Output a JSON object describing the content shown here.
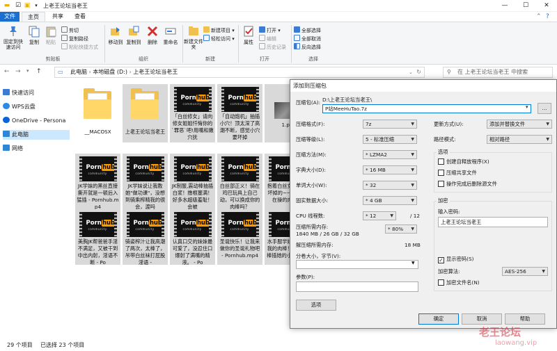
{
  "window": {
    "title": "上老王论坛当老王",
    "controls": [
      "—",
      "☐",
      "✕"
    ]
  },
  "ribbon": {
    "tabs": [
      "文件",
      "主页",
      "共享",
      "查看"
    ],
    "clipboard": {
      "pin": "固定到快速访问",
      "copy": "复制",
      "paste": "粘贴",
      "cut": "剪切",
      "copy_path": "复制路径",
      "paste_shortcut": "粘贴快捷方式",
      "group": "剪贴板"
    },
    "organize": {
      "move_to": "移动到",
      "copy_to": "复制到",
      "delete": "删除",
      "rename": "重命名",
      "group": "组织"
    },
    "new": {
      "new_folder": "新建文件夹",
      "new_item": "新建项目 ▾",
      "easy_access": "轻松访问 ▾",
      "group": "新建"
    },
    "open": {
      "properties": "属性",
      "open": "打开 ▾",
      "edit": "编辑",
      "history": "历史记录",
      "group": "打开"
    },
    "select": {
      "select_all": "全部选择",
      "select_none": "全部取消",
      "invert": "反向选择",
      "group": "选择"
    }
  },
  "address": {
    "crumbs": [
      "此电脑",
      "本地磁盘 (D:)",
      "上老王论坛当老王"
    ],
    "search_placeholder": "在 上老王论坛当老王 中搜索"
  },
  "navpane": {
    "items": [
      "快速访问",
      "WPS云盘",
      "OneDrive - Persona",
      "此电脑",
      "网络"
    ]
  },
  "files": [
    {
      "name": "__MACOSX",
      "kind": "folder"
    },
    {
      "name": "上老王论坛当老王",
      "kind": "folder"
    },
    {
      "name": "「白丝修女」请向修女姐姐忏悔你的`罪恶`吧!用嘴和嫩穴抚",
      "kind": "video"
    },
    {
      "name": "「自动炮机」抽插小穴！顶太深了高潮不断，感觉小穴要坏掉",
      "kind": "video"
    },
    {
      "name": "1.pn",
      "kind": "image"
    },
    {
      "name": "JK学妹的黑丝直接撕开就是一顿后入猛插 - Pornhub.mp4",
      "kind": "video"
    },
    {
      "name": "JK学妹说让我教她\"做功课\"，没想到骑乘榨精我的很会，渡吗",
      "kind": "video"
    },
    {
      "name": "JK制服,震动棒抽插白浆！撸根塞满！好多水超级羞耻！会被",
      "kind": "video"
    },
    {
      "name": "白丝部正义！骑在鸡巴玩具上自己动，可以换成你的肉棒吗？",
      "kind": "video"
    },
    {
      "name": "抱着白丝女友被操坏掉的~一只被正在操的肉便器",
      "kind": "video"
    },
    {
      "name": "美胸JK帮爸爸手淫不满足，又被干到中出内射，淫语不断 - Po",
      "kind": "video"
    },
    {
      "name": "骑姿榨汁让我高潮了两次，太棒了，吊带白丝袜打屁股 淫语 -",
      "kind": "video"
    },
    {
      "name": "认真口交的妹妹最可爱了，没忍住口爆射了满嘴的精液。 - Po",
      "kind": "video"
    },
    {
      "name": "圣诞快乐！让我来做你的圣诞礼物吧 - Pornhub.mp4",
      "kind": "video"
    },
    {
      "name": "水手服学妹喜欢看我的肉棒！我用肉棒插她的小穴 - Po",
      "kind": "video"
    }
  ],
  "thumb_brand": {
    "a": "Porn",
    "b": "hub",
    "sub": "community"
  },
  "status": {
    "count": "29 个项目",
    "selected": "已选择 23 个项目"
  },
  "dialog": {
    "title": "添加到压缩包",
    "archive_label": "压缩包(A):",
    "archive_path": "D:\\上老王论坛当老王\\",
    "archive_name": "P站MeeHuTao.7z",
    "browse": "...",
    "format_label": "压缩格式(F):",
    "format": "7z",
    "level_label": "压缩等级(L):",
    "level": "5 - 标准压缩",
    "method_label": "压缩方法(M):",
    "method": "* LZMA2",
    "dict_label": "字典大小(D):",
    "dict": "* 16 MB",
    "word_label": "单词大小(W):",
    "word": "* 32",
    "solid_label": "固实数据大小:",
    "solid": "* 4 GB",
    "cpu_label": "CPU 线程数:",
    "cpu": "* 12",
    "cpu_total": "/ 12",
    "mem_label": "压缩所需内存:",
    "mem_value": "1840 MB / 26 GB / 32 GB",
    "mem_pct": "* 80%",
    "demem_label": "解压缩所需内存:",
    "demem_value": "18 MB",
    "split_label": "分卷大小，字节(V):",
    "params_label": "参数(P):",
    "options_button": "选项",
    "update_label": "更新方式(U):",
    "update": "添加并替换文件",
    "path_label": "路径模式:",
    "path": "相对路径",
    "options_group": "选项",
    "opt_sfx": "创建自释放程序(X)",
    "opt_shared": "压缩共享文件",
    "opt_delete": "操作完成后删除源文件",
    "enc_group": "加密",
    "password_label": "输入密码:",
    "password": "上老王论坛当老王",
    "show_password": "显示密码(S)",
    "enc_method_label": "加密算法:",
    "enc_method": "AES-256",
    "enc_names": "加密文件名(N)",
    "ok": "确定",
    "cancel": "取消",
    "help": "帮助"
  },
  "watermark": {
    "main": "老王论坛",
    "sub": "laowang.vip"
  }
}
